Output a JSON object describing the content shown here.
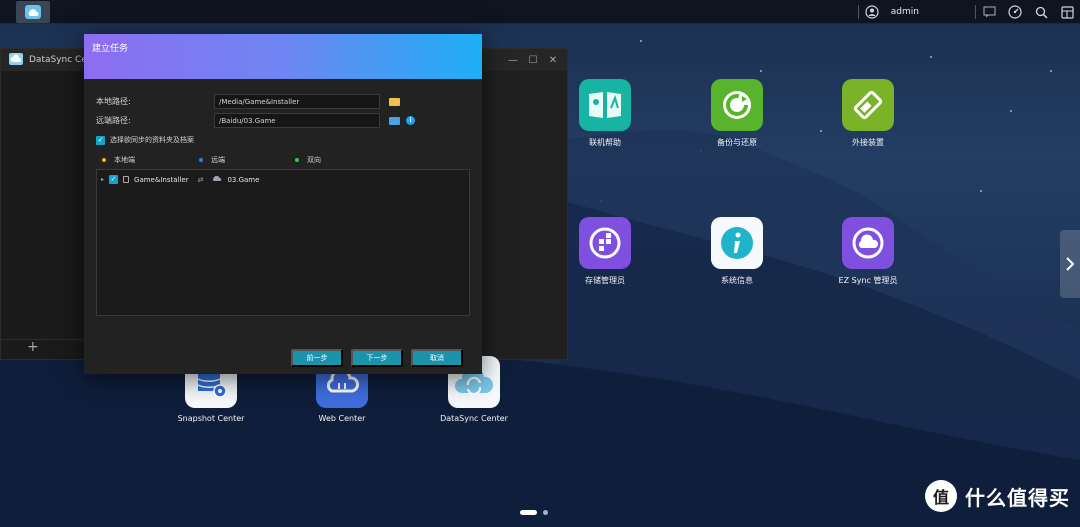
{
  "topbar": {
    "username": "admin",
    "icons": [
      "datasync-taskbar-icon",
      "user-icon",
      "chat-icon",
      "dashboard-icon",
      "search-icon",
      "widgets-icon"
    ]
  },
  "background_window": {
    "title": "DataSync Center",
    "add_symbol": "+",
    "controls": [
      "—",
      "☐",
      "✕"
    ]
  },
  "desktop": {
    "apps": [
      {
        "label": "联机帮助",
        "icon": "help-book-icon",
        "color": "#17b3a3"
      },
      {
        "label": "备份与还原",
        "icon": "backup-restore-icon",
        "color": "#58b42c"
      },
      {
        "label": "外接装置",
        "icon": "external-device-icon",
        "color": "#7ab328"
      },
      {
        "label": "存储管理员",
        "icon": "storage-manager-icon",
        "color": "#7f4fe0"
      },
      {
        "label": "系统信息",
        "icon": "system-info-icon",
        "color": "#ffffff"
      },
      {
        "label": "EZ Sync 管理员",
        "icon": "ez-sync-icon",
        "color": "#7f4fe0"
      },
      {
        "label": "Snapshot Center",
        "icon": "snapshot-center-icon",
        "color": "#ffffff"
      },
      {
        "label": "Web Center",
        "icon": "web-center-icon",
        "color": "#3f6ee0"
      },
      {
        "label": "DataSync Center",
        "icon": "datasync-center-icon",
        "color": "#ffffff"
      }
    ],
    "pager": {
      "current": 1,
      "total": 2
    }
  },
  "dialog": {
    "title": "建立任务",
    "local_path_label": "本地路径:",
    "local_path_value": "/Media/Game&Installer",
    "remote_path_label": "远端路径:",
    "remote_path_value": "/Baidu/03.Game",
    "select_folders_label": "选择欲同步的资料夹及档案",
    "select_folders_checked": true,
    "legend": [
      {
        "label": "本地端",
        "color": "#f5b400"
      },
      {
        "label": "远端",
        "color": "#2f80ed"
      },
      {
        "label": "双向",
        "color": "#2ecc40"
      }
    ],
    "tree": [
      {
        "local": "Game&Installer",
        "remote": "03.Game",
        "checked": true
      }
    ],
    "buttons": {
      "prev": "前一步",
      "next": "下一步",
      "cancel": "取消"
    }
  },
  "watermark": {
    "symbol": "值",
    "text": "什么值得买"
  }
}
